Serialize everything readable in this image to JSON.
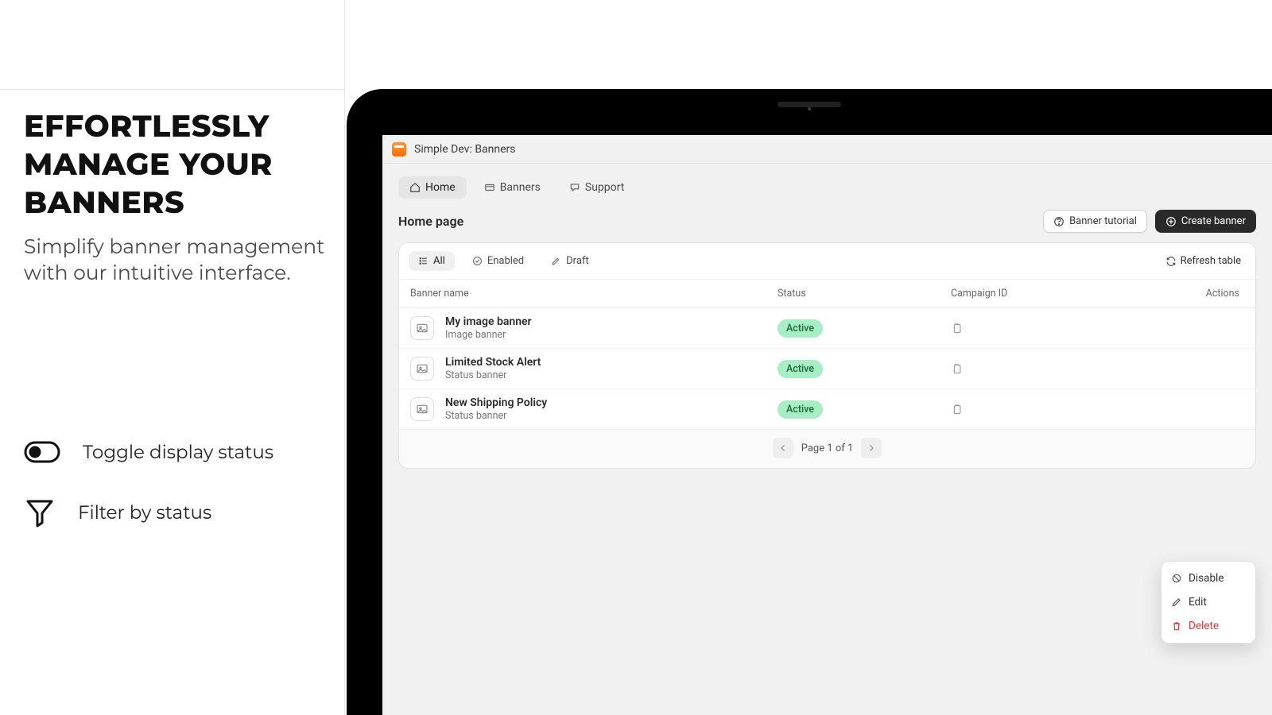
{
  "marketing": {
    "headline": "EFFORTLESSLY MANAGE YOUR BANNERS",
    "subhead": "Simplify banner management with our intuitive interface.",
    "features": [
      {
        "icon": "toggle-icon",
        "text": "Toggle display status"
      },
      {
        "icon": "funnel-icon",
        "text": "Filter by status"
      }
    ]
  },
  "app": {
    "window_title": "Simple Dev: Banners",
    "tabs": [
      {
        "label": "Home",
        "icon": "home-icon",
        "active": true
      },
      {
        "label": "Banners",
        "icon": "banners-icon",
        "active": false
      },
      {
        "label": "Support",
        "icon": "support-icon",
        "active": false
      }
    ],
    "page_title": "Home page",
    "header_actions": {
      "tutorial_label": "Banner tutorial",
      "create_label": "Create banner"
    },
    "filters": [
      {
        "label": "All",
        "icon": "list-icon",
        "active": true
      },
      {
        "label": "Enabled",
        "icon": "check-icon",
        "active": false
      },
      {
        "label": "Draft",
        "icon": "edit-icon",
        "active": false
      }
    ],
    "refresh_label": "Refresh table",
    "columns": {
      "name": "Banner name",
      "status": "Status",
      "campaign": "Campaign ID",
      "actions": "Actions"
    },
    "rows": [
      {
        "title": "My image banner",
        "subtitle": "Image banner",
        "status": "Active"
      },
      {
        "title": "Limited Stock Alert",
        "subtitle": "Status banner",
        "status": "Active"
      },
      {
        "title": "New Shipping Policy",
        "subtitle": "Status banner",
        "status": "Active"
      }
    ],
    "pager": {
      "text": "Page 1 of 1"
    },
    "context_menu": [
      {
        "label": "Disable",
        "icon": "disable-icon"
      },
      {
        "label": "Edit",
        "icon": "pencil-icon"
      },
      {
        "label": "Delete",
        "icon": "trash-icon",
        "danger": true
      }
    ],
    "colors": {
      "badge_active_bg": "#a8edc4",
      "badge_active_fg": "#1a6b3a"
    }
  }
}
